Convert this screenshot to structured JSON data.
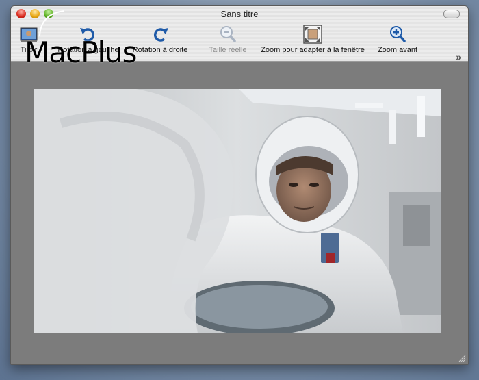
{
  "window": {
    "title": "Sans titre"
  },
  "toolbar": {
    "items": [
      {
        "label": "Tiroir",
        "icon": "drawer-icon",
        "enabled": true
      },
      {
        "label": "Rotation à gauche",
        "icon": "rotate-left-icon",
        "enabled": true
      },
      {
        "label": "Rotation à droite",
        "icon": "rotate-right-icon",
        "enabled": true
      },
      {
        "label": "Taille réelle",
        "icon": "actual-size-icon",
        "enabled": false
      },
      {
        "label": "Zoom pour adapter à la fenêtre",
        "icon": "zoom-to-fit-icon",
        "enabled": true
      },
      {
        "label": "Zoom avant",
        "icon": "zoom-in-icon",
        "enabled": true
      }
    ],
    "overflow": "»"
  },
  "watermark": {
    "text": "MacPlus"
  },
  "content": {
    "image_icon": "cleanroom-photo",
    "background": "#7c7c7c"
  },
  "colors": {
    "accent_blue": "#1e5aa8",
    "disabled_gray": "#8e8e8e"
  }
}
